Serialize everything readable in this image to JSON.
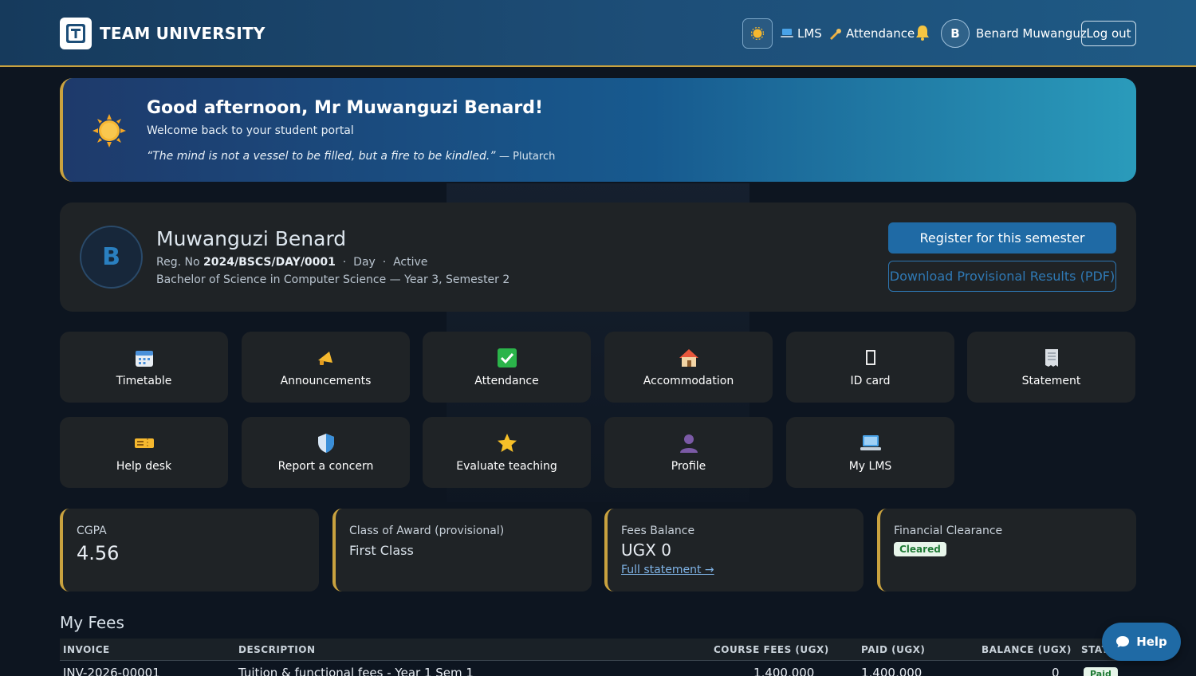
{
  "header": {
    "brand": "TEAM UNIVERSITY",
    "nav_lms": "LMS",
    "nav_attendance": "Attendance",
    "user_initial": "B",
    "username": "Benard Muwanguzi",
    "logout": "Log out"
  },
  "greeting": {
    "title": "Good afternoon, Mr Muwanguzi Benard!",
    "subtitle": "Welcome back to your student portal",
    "quote": "“The mind is not a vessel to be filled, but a fire to be kindled.”",
    "author": "— Plutarch"
  },
  "profile": {
    "initial": "B",
    "name": "Muwanguzi Benard",
    "reg_label": "Reg. No",
    "reg_no": "2024/BSCS/DAY/0001",
    "mode": "Day",
    "status": "Active",
    "programme": "Bachelor of Science in Computer Science — Year 3, Semester 2",
    "register_button": "Register for this semester",
    "download_button": "Download Provisional Results (PDF)"
  },
  "tiles": [
    {
      "label": "Timetable",
      "icon": "calendar-icon"
    },
    {
      "label": "Announcements",
      "icon": "megaphone-icon"
    },
    {
      "label": "Attendance",
      "icon": "check-icon"
    },
    {
      "label": "Accommodation",
      "icon": "house-icon"
    },
    {
      "label": "ID card",
      "icon": "id-card-icon"
    },
    {
      "label": "Statement",
      "icon": "receipt-icon"
    },
    {
      "label": "Help desk",
      "icon": "ticket-icon"
    },
    {
      "label": "Report a concern",
      "icon": "shield-icon"
    },
    {
      "label": "Evaluate teaching",
      "icon": "star-icon"
    },
    {
      "label": "Profile",
      "icon": "person-icon"
    },
    {
      "label": "My LMS",
      "icon": "laptop-icon"
    }
  ],
  "stats": {
    "cgpa_label": "CGPA",
    "cgpa_value": "4.56",
    "award_label": "Class of Award (provisional)",
    "award_value": "First Class",
    "fees_label": "Fees Balance",
    "fees_value": "UGX 0",
    "fees_link": "Full statement →",
    "clearance_label": "Financial Clearance",
    "clearance_value": "Cleared"
  },
  "fees": {
    "title": "My Fees",
    "columns": [
      "INVOICE",
      "DESCRIPTION",
      "COURSE FEES (UGX)",
      "PAID (UGX)",
      "BALANCE (UGX)",
      "STAT"
    ],
    "rows": [
      {
        "invoice": "INV-2026-00001",
        "description": "Tuition & functional fees - Year 1 Sem 1",
        "course_fees": "1,400,000",
        "paid": "1,400,000",
        "balance": "0",
        "status": "Paid"
      }
    ]
  },
  "help_button": "Help",
  "colors": {
    "accent_gold": "#c9a23f",
    "primary_blue": "#1f6aa5",
    "card_bg": "#1f2326",
    "page_bg": "#0d1520"
  }
}
